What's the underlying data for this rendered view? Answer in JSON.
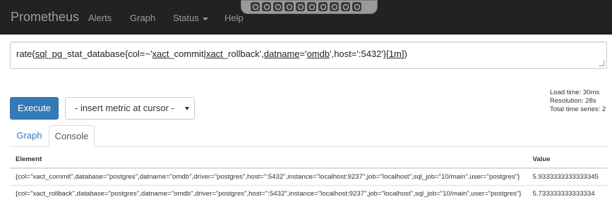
{
  "navbar": {
    "brand": "Prometheus",
    "links": [
      "Alerts",
      "Graph",
      "Status",
      "Help"
    ]
  },
  "extension_toolbar": {
    "icons": [
      "home-icon",
      "shield-icon",
      "circle-icon",
      "clock-icon",
      "cube-icon",
      "lock-icon",
      "settings-icon",
      "window-icon",
      "square-icon",
      "stop-icon"
    ]
  },
  "expression": {
    "value": "rate(sql_pg_stat_database{col=~'xact_commit|xact_rollback',datname='omdb',host=':5432'}[1m])",
    "parts": {
      "p1": "rate(",
      "p2": "sql",
      "p3": "_",
      "p4": "pg",
      "p5": "_stat_database{col=~'",
      "p6": "xact",
      "p7": "_commit|",
      "p8": "xact",
      "p9": "_rollback',",
      "p10": "datname",
      "p11": "='",
      "p12": "omdb",
      "p13": "',host=':5432'}",
      "p14": "[1m]",
      "p15": ")"
    }
  },
  "stats": {
    "load_time": "Load time: 30ms",
    "resolution": "Resolution: 28s",
    "total_series": "Total time series: 2"
  },
  "controls": {
    "execute_label": "Execute",
    "insert_metric_placeholder": "- insert metric at cursor -"
  },
  "tabs": {
    "graph": "Graph",
    "console": "Console",
    "active": "Console"
  },
  "table": {
    "headers": {
      "element": "Element",
      "value": "Value"
    },
    "rows": [
      {
        "element": "{col=\"xact_commit\",database=\"postgres\",datname=\"omdb\",driver=\"postgres\",host=\":5432\",instance=\"localhost:9237\",job=\"localhost\",sql_job=\"10/main\",user=\"postgres\"}",
        "value": "5.9333333333333345"
      },
      {
        "element": "{col=\"xact_rollback\",database=\"postgres\",datname=\"omdb\",driver=\"postgres\",host=\":5432\",instance=\"localhost:9237\",job=\"localhost\",sql_job=\"10/main\",user=\"postgres\"}",
        "value": "5.733333333333334"
      }
    ]
  },
  "colors": {
    "navbar_bg": "#222222",
    "nav_text": "#9d9d9d",
    "primary": "#337ab7",
    "border": "#dddddd"
  }
}
